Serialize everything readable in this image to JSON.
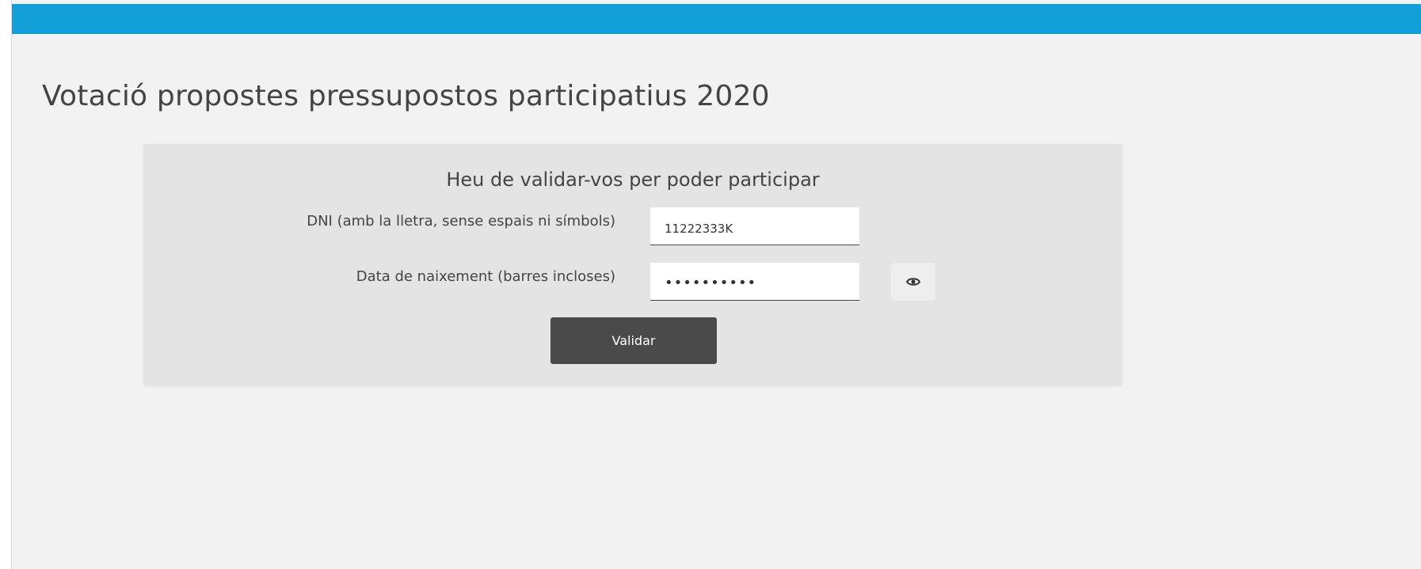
{
  "header": {
    "bar_color": "#13a0d9"
  },
  "page_title": "Votació propostes pressupostos participatius 2020",
  "form": {
    "heading": "Heu de validar-vos per poder participar",
    "dni": {
      "label": "DNI (amb la lletra, sense espais ni símbols)",
      "value": "11222333K"
    },
    "birthdate": {
      "label": "Data de naixement (barres incloses)",
      "value": "••••••••••",
      "toggle_icon": "eye-icon"
    },
    "submit_label": "Validar"
  }
}
